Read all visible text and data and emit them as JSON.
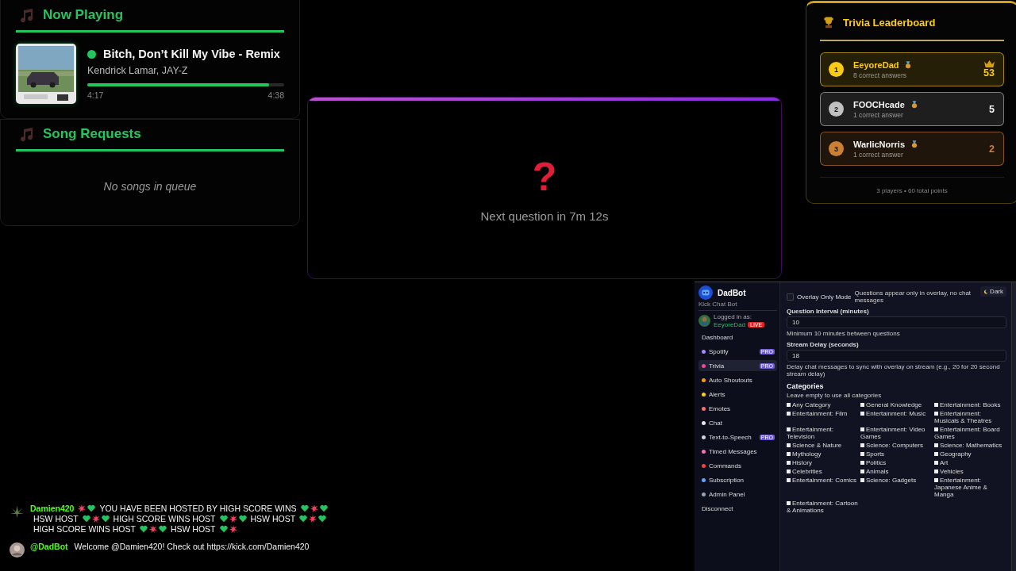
{
  "now_playing": {
    "title": "Now Playing",
    "track": {
      "title": "Bitch, Don’t Kill My Vibe - Remix",
      "artist": "Kendrick Lamar, JAY-Z",
      "playing": true,
      "elapsed": "4:17",
      "duration": "4:38",
      "level": 0.925
    }
  },
  "song_requests": {
    "title": "Song Requests",
    "empty_text": "No songs in queue"
  },
  "trivia": {
    "symbol": "?",
    "countdown": "Next question in 7m 12s"
  },
  "leaderboard": {
    "title": "Trivia Leaderboard",
    "players": [
      {
        "rank": "1",
        "name": "EeyoreDad",
        "answers": "8 correct answers",
        "points": "53",
        "color": "#facc15",
        "crown": true
      },
      {
        "rank": "2",
        "name": "FOOCHcade",
        "answers": "1 correct answer",
        "points": "5",
        "color": "#c0c0c0",
        "crown": false
      },
      {
        "rank": "3",
        "name": "WarlicNorris",
        "answers": "1 correct answer",
        "points": "2",
        "color": "#cd7f32",
        "crown": false
      }
    ],
    "footer": "3 players • 60 total points"
  },
  "dashboard": {
    "brand": "DadBot",
    "tagline": "Kick Chat Bot",
    "login_label": "Logged in as:",
    "user": "EeyoreDad",
    "live_badge": "LIVE",
    "theme_button": "Dark",
    "nav": [
      {
        "label": "Dashboard",
        "selected": false
      },
      {
        "label": "Spotify",
        "badge": "PRO",
        "selected": false
      },
      {
        "label": "Trivia",
        "badge": "PRO",
        "selected": true
      },
      {
        "label": "Auto Shoutouts",
        "selected": false
      },
      {
        "label": "Alerts",
        "selected": false
      },
      {
        "label": "Emotes",
        "selected": false
      },
      {
        "label": "Chat",
        "selected": false
      },
      {
        "label": "Text-to-Speech",
        "badge": "PRO",
        "selected": false
      },
      {
        "label": "Timed Messages",
        "selected": false
      },
      {
        "label": "Commands",
        "selected": false
      },
      {
        "label": "Subscription",
        "selected": false
      },
      {
        "label": "Admin Panel",
        "selected": false
      },
      {
        "label": "Disconnect",
        "selected": false
      }
    ],
    "overlay_only": {
      "label": "Overlay Only Mode",
      "hint": "Questions appear only in overlay, no chat messages",
      "checked": false
    },
    "fields": [
      {
        "label": "Question Interval (minutes)",
        "value": "10",
        "hint": "Minimum 10 minutes between questions"
      },
      {
        "label": "Stream Delay (seconds)",
        "value": "18",
        "hint": "Delay chat messages to sync with overlay on stream (e.g., 20 for 20 second stream delay)"
      }
    ],
    "categories_title": "Categories",
    "categories_hint": "Leave empty to use all categories",
    "categories": [
      {
        "label": "Any Category",
        "checked": false
      },
      {
        "label": "General Knowledge",
        "checked": false
      },
      {
        "label": "Entertainment: Books",
        "checked": false
      },
      {
        "label": "Entertainment: Film",
        "checked": false
      },
      {
        "label": "Entertainment: Music",
        "checked": false
      },
      {
        "label": "Entertainment: Musicals & Theatres",
        "checked": false
      },
      {
        "label": "Entertainment: Television",
        "checked": false
      },
      {
        "label": "Entertainment: Video Games",
        "checked": false
      },
      {
        "label": "Entertainment: Board Games",
        "checked": false
      },
      {
        "label": "Science & Nature",
        "checked": false
      },
      {
        "label": "Science: Computers",
        "checked": false
      },
      {
        "label": "Science: Mathematics",
        "checked": false
      },
      {
        "label": "Mythology",
        "checked": false
      },
      {
        "label": "Sports",
        "checked": false
      },
      {
        "label": "Geography",
        "checked": false
      },
      {
        "label": "History",
        "checked": false
      },
      {
        "label": "Politics",
        "checked": false
      },
      {
        "label": "Art",
        "checked": false
      },
      {
        "label": "Celebrities",
        "checked": false
      },
      {
        "label": "Animals",
        "checked": false
      },
      {
        "label": "Vehicles",
        "checked": false
      },
      {
        "label": "Entertainment: Comics",
        "checked": false
      },
      {
        "label": "Science: Gadgets",
        "checked": false
      },
      {
        "label": "Entertainment: Japanese Anime & Manga",
        "checked": false
      },
      {
        "label": "Entertainment: Cartoon & Animations",
        "checked": false
      }
    ]
  },
  "chat": [
    {
      "user": "Damien420",
      "parts": [
        {
          "kind": "spark"
        },
        {
          "kind": "heart"
        },
        {
          "kind": "text",
          "text": "YOU HAVE BEEN HOSTED BY HIGH SCORE WINS"
        },
        {
          "kind": "heart"
        },
        {
          "kind": "spark"
        },
        {
          "kind": "heart"
        },
        {
          "kind": "text",
          "text": "HSW HOST"
        },
        {
          "kind": "heart"
        },
        {
          "kind": "spark"
        },
        {
          "kind": "heart"
        },
        {
          "kind": "text",
          "text": "HIGH SCORE WINS HOST"
        },
        {
          "kind": "heart"
        },
        {
          "kind": "spark"
        },
        {
          "kind": "heart"
        },
        {
          "kind": "text",
          "text": "HSW HOST"
        },
        {
          "kind": "heart"
        },
        {
          "kind": "spark"
        },
        {
          "kind": "heart"
        },
        {
          "kind": "text",
          "text": "HIGH SCORE WINS HOST"
        },
        {
          "kind": "heart"
        },
        {
          "kind": "spark"
        },
        {
          "kind": "heart"
        },
        {
          "kind": "text",
          "text": "HSW HOST"
        },
        {
          "kind": "heart"
        },
        {
          "kind": "spark"
        }
      ]
    },
    {
      "user": "@DadBot",
      "parts": [
        {
          "kind": "text",
          "text": "Welcome @Damien420! Check out https://kick.com/Damien420"
        }
      ]
    }
  ]
}
